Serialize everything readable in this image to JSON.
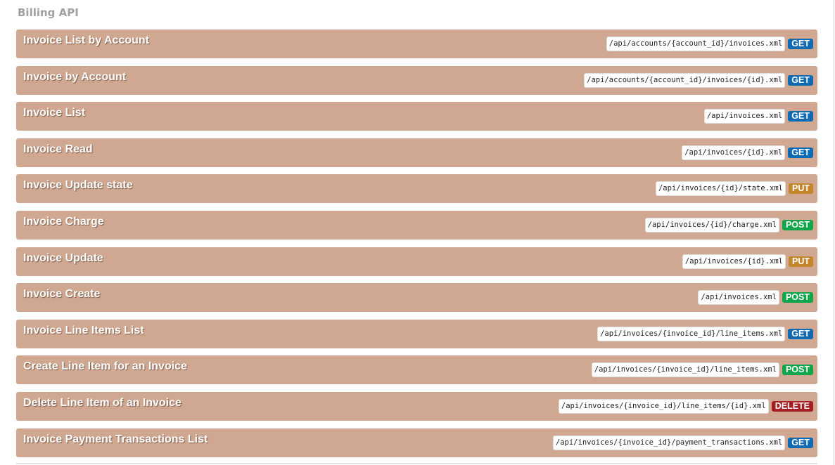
{
  "section": {
    "title": "Billing API"
  },
  "endpoints": [
    {
      "title": "Invoice List by Account",
      "path": "/api/accounts/{account_id}/invoices.xml",
      "method": "GET"
    },
    {
      "title": "Invoice by Account",
      "path": "/api/accounts/{account_id}/invoices/{id}.xml",
      "method": "GET"
    },
    {
      "title": "Invoice List",
      "path": "/api/invoices.xml",
      "method": "GET"
    },
    {
      "title": "Invoice Read",
      "path": "/api/invoices/{id}.xml",
      "method": "GET"
    },
    {
      "title": "Invoice Update state",
      "path": "/api/invoices/{id}/state.xml",
      "method": "PUT"
    },
    {
      "title": "Invoice Charge",
      "path": "/api/invoices/{id}/charge.xml",
      "method": "POST"
    },
    {
      "title": "Invoice Update",
      "path": "/api/invoices/{id}.xml",
      "method": "PUT"
    },
    {
      "title": "Invoice Create",
      "path": "/api/invoices.xml",
      "method": "POST"
    },
    {
      "title": "Invoice Line Items List",
      "path": "/api/invoices/{invoice_id}/line_items.xml",
      "method": "GET"
    },
    {
      "title": "Create Line Item for an Invoice",
      "path": "/api/invoices/{invoice_id}/line_items.xml",
      "method": "POST"
    },
    {
      "title": "Delete Line Item of an Invoice",
      "path": "/api/invoices/{invoice_id}/line_items/{id}.xml",
      "method": "DELETE"
    },
    {
      "title": "Invoice Payment Transactions List",
      "path": "/api/invoices/{invoice_id}/payment_transactions.xml",
      "method": "GET"
    }
  ],
  "colors": {
    "row_background": "#d0a891",
    "section_title": "#a0a0a0",
    "GET": "#0f6ab4",
    "PUT": "#c5862b",
    "POST": "#10a54a",
    "DELETE": "#a41e22"
  }
}
